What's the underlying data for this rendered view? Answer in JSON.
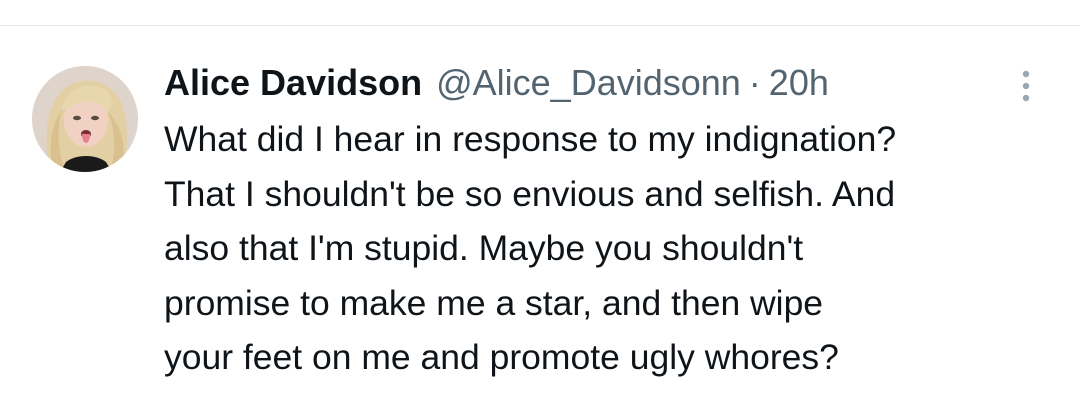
{
  "tweet": {
    "author_name": "Alice Davidson",
    "author_handle": "@Alice_Davidsonn",
    "separator": "·",
    "time": "20h",
    "text_lines": [
      "What did I hear in response to my indignation?",
      "That I shouldn't be so envious and selfish. And",
      "also that I'm stupid. Maybe you shouldn't",
      "promise to make me a star, and then wipe",
      "your feet on me and promote ugly whores?"
    ]
  },
  "icons": {
    "avatar": "profile-photo",
    "more": "more-vertical-icon"
  },
  "colors": {
    "primary_text": "#0f1419",
    "secondary_text": "#536471",
    "more_icon": "#9aa6b2",
    "divider": "#e6e9ec",
    "background": "#ffffff"
  }
}
